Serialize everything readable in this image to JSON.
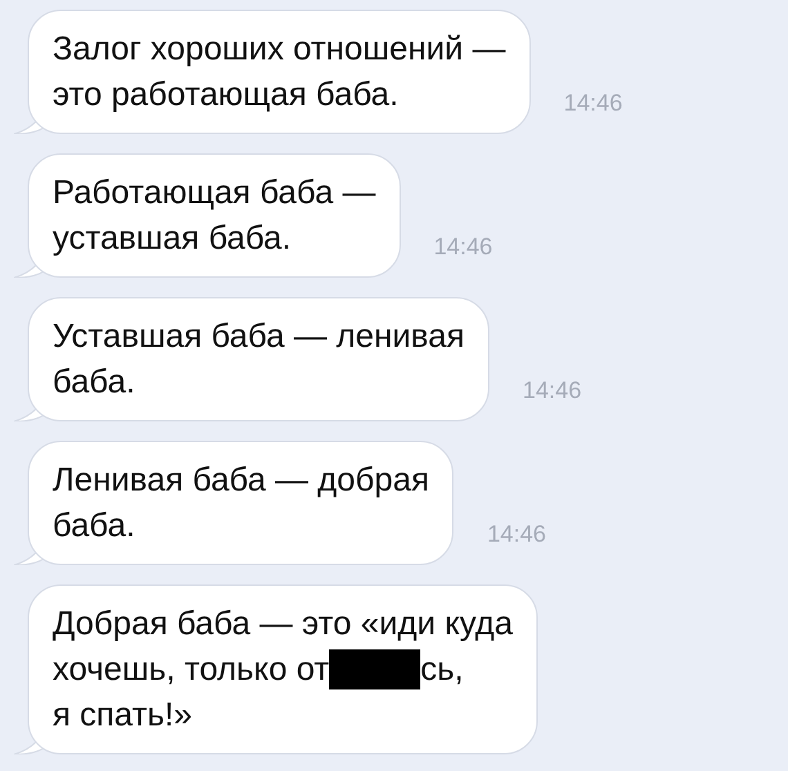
{
  "messages": [
    {
      "lines": [
        [
          "Залог хороших отношений —"
        ],
        [
          "это работающая баба."
        ]
      ],
      "time": "14:46"
    },
    {
      "lines": [
        [
          "Работающая баба —"
        ],
        [
          "уставшая баба."
        ]
      ],
      "time": "14:46"
    },
    {
      "lines": [
        [
          "Уставшая баба — ленивая"
        ],
        [
          "баба."
        ]
      ],
      "time": "14:46"
    },
    {
      "lines": [
        [
          "Ленивая баба — добрая"
        ],
        [
          "баба."
        ]
      ],
      "time": "14:46"
    },
    {
      "lines": [
        [
          "Добрая баба — это «иди куда"
        ],
        [
          "хочешь, только от",
          {
            "kind": "redaction"
          },
          "сь,"
        ],
        [
          "я спать!»"
        ]
      ]
    }
  ]
}
